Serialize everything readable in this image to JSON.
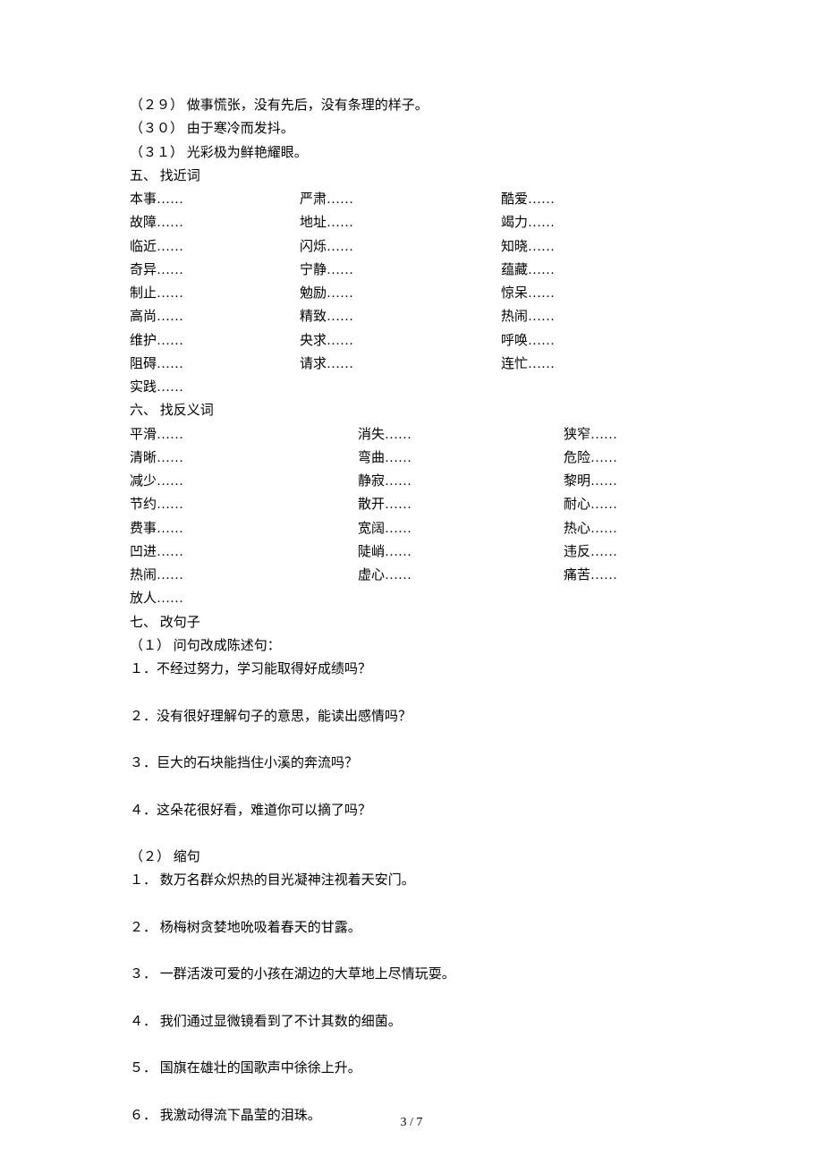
{
  "items29_31": [
    "（２９） 做事慌张，没有先后，没有条理的样子。",
    "（３０） 由于寒冷而发抖。",
    "（３１） 光彩极为鲜艳耀眼。"
  ],
  "section5_heading": "五、 找近词",
  "synonyms": [
    [
      "本事……",
      "严肃……",
      "酷爱……"
    ],
    [
      "故障……",
      "地址……",
      "竭力……"
    ],
    [
      "临近……",
      "闪烁……",
      "知晓……"
    ],
    [
      "奇异……",
      "宁静……",
      "蕴藏……"
    ],
    [
      "制止……",
      "勉励……",
      "惊呆……"
    ],
    [
      "高尚……",
      "精致……",
      "热闹……"
    ],
    [
      "维护……",
      "央求……",
      "呼唤……"
    ],
    [
      "阻碍……",
      "请求……",
      "连忙……"
    ],
    [
      "实践……",
      "",
      ""
    ]
  ],
  "section6_heading": "六、 找反义词",
  "antonyms": [
    [
      "平滑……",
      "消失……",
      "狭窄……"
    ],
    [
      "清晰……",
      "弯曲……",
      "危险……"
    ],
    [
      "减少……",
      "静寂……",
      "黎明……"
    ],
    [
      "节约……",
      "散开……",
      "耐心……"
    ],
    [
      "费事……",
      "宽阔……",
      "热心……"
    ],
    [
      "凹进……",
      "陡峭……",
      "违反……"
    ],
    [
      "热闹……",
      "虚心……",
      "痛苦……"
    ],
    [
      "放人……",
      "",
      ""
    ]
  ],
  "section7_heading": "七、 改句子",
  "sub1_heading": "（１） 问句改成陈述句：",
  "sub1_items": [
    "１．不经过努力，学习能取得好成绩吗？",
    "２．没有很好理解句子的意思，能读出感情吗？",
    "３．巨大的石块能挡住小溪的奔流吗？",
    "４．这朵花很好看，难道你可以摘了吗？"
  ],
  "sub2_heading": "（２） 缩句",
  "sub2_items": [
    "１． 数万名群众炽热的目光凝神注视着天安门。",
    "２． 杨梅树贪婪地吮吸着春天的甘露。",
    "３． 一群活泼可爱的小孩在湖边的大草地上尽情玩耍。",
    "４． 我们通过显微镜看到了不计其数的细菌。",
    "５． 国旗在雄壮的国歌声中徐徐上升。",
    "６． 我激动得流下晶莹的泪珠。"
  ],
  "footer": "3 / 7"
}
